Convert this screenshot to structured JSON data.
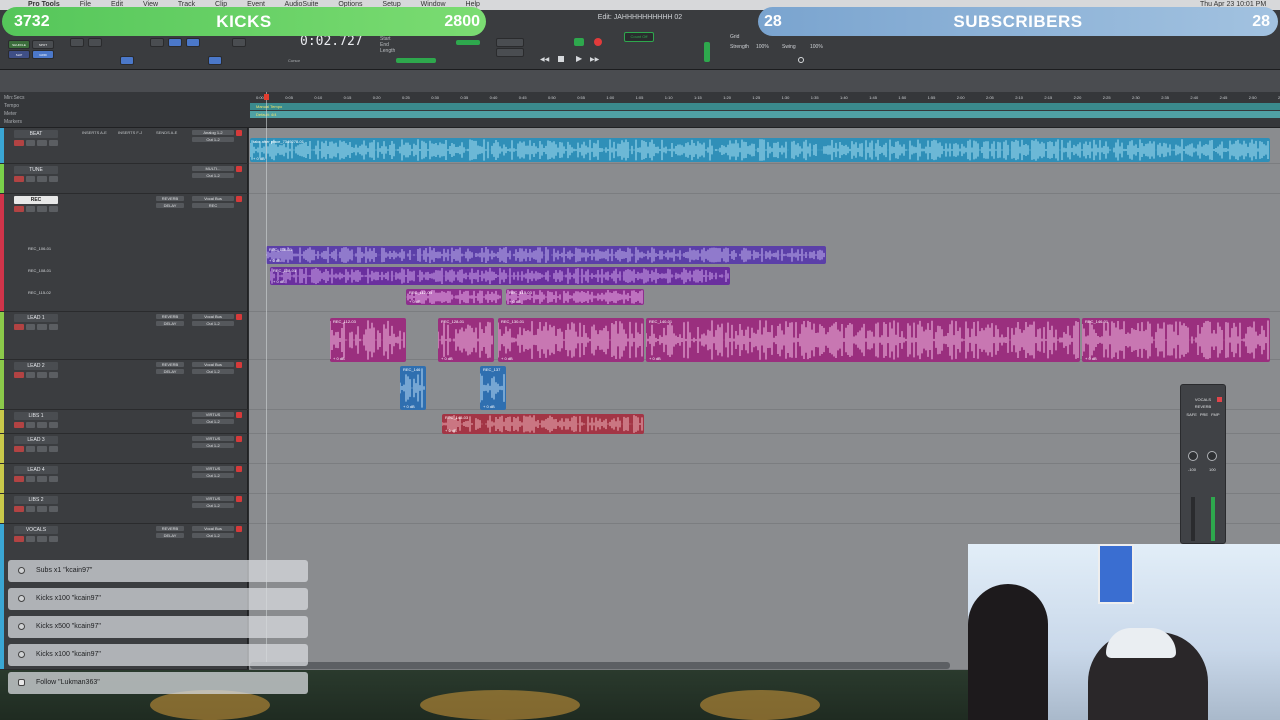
{
  "mac_menu": [
    "Pro Tools",
    "File",
    "Edit",
    "View",
    "Track",
    "Clip",
    "Event",
    "AudioSuite",
    "Options",
    "Setup",
    "Window",
    "Help"
  ],
  "window_title": "Edit: JAHHHHHHHHHH 02",
  "clock": "Thu Apr 23 10:01 PM",
  "counter": "0:02.727",
  "counter_sub": [
    "Start",
    "End",
    "Length"
  ],
  "mode_buttons": [
    "SHUFFLE",
    "SPOT",
    "SLIP",
    "GRID"
  ],
  "transport_labels": {
    "grid": "Grid",
    "strength": "Strength",
    "swing": "Swing",
    "strength_val": "100%",
    "swing_val": "100%",
    "cursor": "Cursor",
    "nudge": "Nudge",
    "countoff": "Count Off"
  },
  "overlay": {
    "left": {
      "left_num": "3732",
      "title": "KICKS",
      "right_num": "2800",
      "color": "#5ec85e"
    },
    "right": {
      "left_num": "28",
      "title": "SUBSCRIBERS",
      "right_num": "28",
      "color": "#8fb3d9"
    }
  },
  "rulers": [
    "Min:Secs",
    "Tempo",
    "Meter",
    "Markers"
  ],
  "ruler_tempo": "Manual Tempo",
  "ruler_meter": "Default: 4/4",
  "ticks": [
    "0:00",
    "0:05",
    "0:10",
    "0:15",
    "0:20",
    "0:25",
    "0:30",
    "0:35",
    "0:40",
    "0:45",
    "0:50",
    "0:55",
    "1:00",
    "1:05",
    "1:10",
    "1:15",
    "1:20",
    "1:25",
    "1:30",
    "1:35",
    "1:40",
    "1:45",
    "1:50",
    "1:55",
    "2:00",
    "2:05",
    "2:10",
    "2:15",
    "2:20",
    "2:25",
    "2:30",
    "2:35",
    "2:40",
    "2:45",
    "2:50",
    "2:55",
    "3:00",
    "3:05",
    "3:10",
    "3:15",
    "3:20",
    "3:25"
  ],
  "header_cols": [
    "INSERTS A-E",
    "INSERTS F-J",
    "SENDS A-E",
    "I/O"
  ],
  "tracks": [
    {
      "name": "BEAT",
      "color": "#3aa6d4",
      "ins1": "",
      "ins2": "",
      "io1": "Analog 1-2",
      "io2": "Out 1-2"
    },
    {
      "name": "TUNE",
      "color": "#7ad04a",
      "ins1": "",
      "ins2": "",
      "io1": "MULTI...",
      "io2": "Out 1-2"
    },
    {
      "name": "REC",
      "color": "#d0344a",
      "ins1": "REVERB",
      "ins2": "DELAY",
      "io1": "Vocal Bus",
      "io2": "REC"
    },
    {
      "name": "LEAD 1",
      "color": "#8bc94a",
      "ins1": "REVERB",
      "ins2": "DELAY",
      "io1": "Vocal Bus",
      "io2": "Out 1-2"
    },
    {
      "name": "LEAD 2",
      "color": "#8bc94a",
      "ins1": "REVERB",
      "ins2": "DELAY",
      "io1": "Vocal Bus",
      "io2": "Out 1-2"
    },
    {
      "name": "LIBS 1",
      "color": "#c8c84a",
      "ins1": "",
      "ins2": "",
      "io1": "VIRTUS",
      "io2": "Out 1-2"
    },
    {
      "name": "LEAD 3",
      "color": "#c8c84a",
      "ins1": "",
      "ins2": "",
      "io1": "VIRTUS",
      "io2": "Out 1-2"
    },
    {
      "name": "LEAD 4",
      "color": "#c8c84a",
      "ins1": "",
      "ins2": "",
      "io1": "VIRTUS",
      "io2": "Out 1-2"
    },
    {
      "name": "LIBS 2",
      "color": "#c8c84a",
      "ins1": "",
      "ins2": "",
      "io1": "VIRTUS",
      "io2": "Out 1-2"
    },
    {
      "name": "VOCALS",
      "color": "#3aa6d4",
      "ins1": "REVERB",
      "ins2": "DELAY",
      "io1": "Vocal Bus",
      "io2": "Out 1-2"
    }
  ],
  "rec_playlists": [
    "REC_106-01",
    "REC_108-01",
    "REC_115-02"
  ],
  "clips": {
    "beat": "take after place_7349278-01",
    "rec_a": "REC_106-01",
    "rec_b": "REC_108-01",
    "rec_c1": "REC_112-03",
    "rec_c2": "REC_115-03",
    "rec_c3": "REC_115-03",
    "lead1_a": "REC_112-03",
    "lead1_b": "REC_128-01",
    "lead1_c": "REC_130-01",
    "lead1_d": "REC_140-01",
    "lead1_e": "REC_146-01",
    "lead2_a": "REC_146",
    "lead2_b": "REC_137",
    "libs1_a": "REC_145-03",
    "gain": "+ 0 dB"
  },
  "plugin": {
    "title": "VOCALS",
    "sub": "REVERB",
    "modes": [
      "SAFE",
      "PRE",
      "FMP"
    ],
    "vals": [
      "-100",
      "100"
    ]
  },
  "alerts": [
    {
      "icon": "star",
      "text": "Subs x1 \"kcain97\""
    },
    {
      "icon": "x",
      "text": "Kicks x100 \"kcain97\""
    },
    {
      "icon": "x",
      "text": "Kicks x500 \"kcain97\""
    },
    {
      "icon": "x",
      "text": "Kicks x100 \"kcain97\""
    },
    {
      "icon": "heart",
      "text": "Follow \"Lukman363\""
    }
  ]
}
